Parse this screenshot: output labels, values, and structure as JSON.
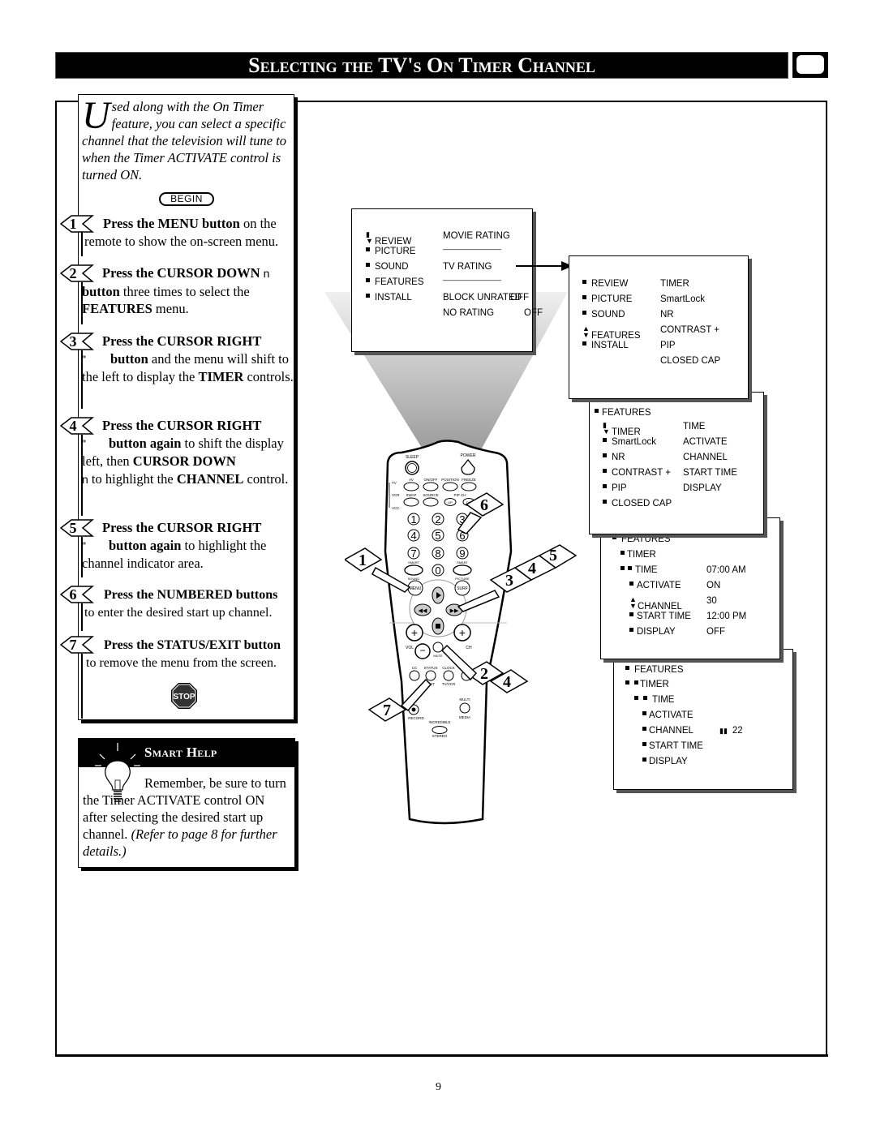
{
  "title": "Selecting the TV's On Timer Channel",
  "intro": {
    "dropcap": "U",
    "text": "sed along with the On Timer feature, you can select a specific channel that the television will tune to when the Timer ACTIVATE control is turned ON."
  },
  "begin_label": "BEGIN",
  "steps": [
    {
      "number": "1",
      "bold": "Press the MENU button",
      "rest": " on the remote to show the on-screen menu."
    },
    {
      "number": "2",
      "bold": "Press the CURSOR DOWN",
      "glyph": "n",
      "bold2": "button",
      "rest": " three times to select the ",
      "bold3": "FEATURES",
      "rest2": " menu."
    },
    {
      "number": "3",
      "bold": "Press the CURSOR RIGHT",
      "glyph": "\"",
      "bold2": "button",
      "rest": " and the menu will shift to the left to display the ",
      "bold3": "TIMER",
      "rest2": " controls."
    },
    {
      "number": "4",
      "bold": "Press the CURSOR RIGHT",
      "glyph": "\"",
      "bold2": "button again",
      "rest": " to shift the display left, then ",
      "bold3": "CURSOR DOWN",
      "glyph2": "n",
      "rest2": " to highlight the ",
      "bold4": "CHANNEL",
      "rest3": " control."
    },
    {
      "number": "5",
      "bold": "Press the CURSOR RIGHT",
      "glyph": "\"",
      "bold2": "button again",
      "rest": " to highlight the channel indicator area."
    },
    {
      "number": "6",
      "bold": "Press the NUMBERED buttons",
      "rest": "to enter the desired start up channel."
    },
    {
      "number": "7",
      "bold": "Press the STATUS/EXIT button",
      "rest": "to remove the menu from the screen."
    }
  ],
  "stop_label": "STOP",
  "smart_help": {
    "title": "Smart Help",
    "text": "Remember, be sure to turn the Timer ACTIVATE control ON after selecting the desired start up channel.",
    "italic": "(Refer to page 8 for further details.)"
  },
  "menus": {
    "main": {
      "left": [
        "REVIEW",
        "PICTURE",
        "SOUND",
        "FEATURES",
        "INSTALL"
      ],
      "right": [
        "MOVIE RATING",
        "————————",
        "TV RATING",
        "————————",
        "BLOCK UNRATED",
        "NO RATING"
      ],
      "right_values": [
        "",
        "",
        "",
        "",
        "OFF",
        "OFF"
      ]
    },
    "features": {
      "left": [
        "REVIEW",
        "PICTURE",
        "SOUND",
        "FEATURES",
        "INSTALL"
      ],
      "right": [
        "TIMER",
        "SmartLock",
        "NR",
        "CONTRAST +",
        "PIP",
        "CLOSED CAP"
      ]
    },
    "timer": {
      "header": "FEATURES",
      "left": [
        "TIMER",
        "SmartLock",
        "NR",
        "CONTRAST +",
        "PIP",
        "CLOSED CAP"
      ],
      "right": [
        "TIME",
        "ACTIVATE",
        "CHANNEL",
        "START TIME",
        "DISPLAY"
      ]
    },
    "timer_settings": {
      "header": "FEATURES",
      "sub": "TIMER",
      "rows": [
        {
          "label": "TIME",
          "value": "07:00 AM"
        },
        {
          "label": "ACTIVATE",
          "value": "ON"
        },
        {
          "label": "CHANNEL",
          "value": "30"
        },
        {
          "label": "START TIME",
          "value": "12:00 PM"
        },
        {
          "label": "DISPLAY",
          "value": "OFF"
        }
      ]
    },
    "channel_entry": {
      "header": "FEATURES",
      "sub": "TIMER",
      "rows": [
        {
          "label": "TIME",
          "value": ""
        },
        {
          "label": "ACTIVATE",
          "value": ""
        },
        {
          "label": "CHANNEL",
          "value": "22"
        },
        {
          "label": "START TIME",
          "value": ""
        },
        {
          "label": "DISPLAY",
          "value": ""
        }
      ]
    }
  },
  "remote": {
    "labels": {
      "sleep": "SLEEP",
      "power": "POWER",
      "tv": "TV",
      "vcr": "VCR",
      "acc": "ACC",
      "av": "AV",
      "onoff": "ON/OFF",
      "position": "POSITION",
      "freeze": "FREEZE",
      "swap": "SWAP",
      "source": "SOURCE",
      "pipch": "PIP CH",
      "up": "UP",
      "dn": "DN",
      "smart_sound_top": "SMART",
      "smart_sound": "SOUND",
      "smart_pic_top": "SMART",
      "smart_pic": "PICTURE",
      "menu": "MENU",
      "surf": "SURF",
      "vol": "VOL",
      "ch": "CH",
      "mute": "MUTE",
      "cc": "CC",
      "status": "STATUS",
      "exit": "EXIT",
      "clock": "CLOCK",
      "tvvcr": "TV/VCR",
      "multi": "MULTI",
      "media": "MEDIA",
      "record": "RECORD",
      "incredible": "INCREDIBLE",
      "stereo": "STEREO"
    },
    "digits": [
      "1",
      "2",
      "3",
      "4",
      "5",
      "6",
      "7",
      "8",
      "9",
      "0"
    ],
    "callouts": [
      "1",
      "2",
      "3",
      "4",
      "5",
      "6",
      "7",
      "4"
    ]
  },
  "page_number": "9"
}
